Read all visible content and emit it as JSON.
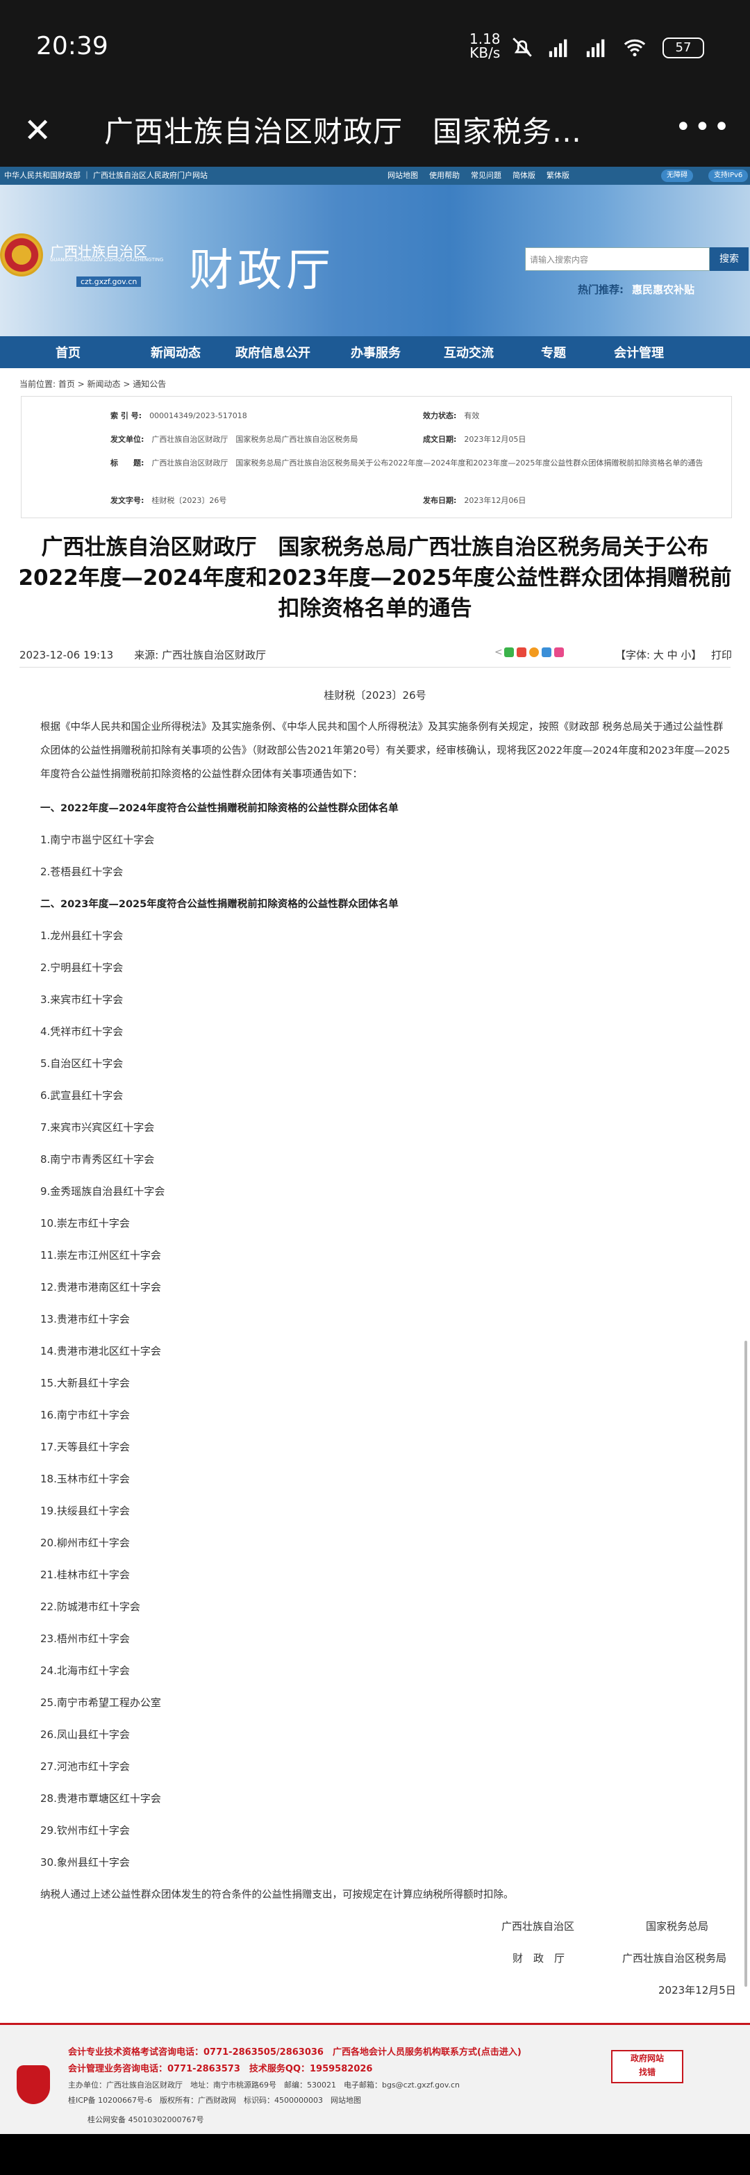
{
  "status": {
    "time": "20:39",
    "speed_top": "1.18",
    "speed_bottom": "KB/s",
    "battery": "57",
    "net1": "HD",
    "net2": "HD"
  },
  "title_bar": {
    "title": "广西壮族自治区财政厅　国家税务…"
  },
  "top_strip": {
    "left": "中华人民共和国财政部 ｜ 广西壮族自治区人民政府门户网站",
    "links": [
      "网站地图",
      "使用帮助",
      "常见问题",
      "简体版",
      "繁体版"
    ],
    "pill1": "无障碍",
    "pill2": "支持IPv6"
  },
  "header": {
    "region": "广西壮族自治区",
    "pinyin": "GUANGXI ZHUANGZU ZIZHIQU CAIZHENGTING",
    "url": "czt.gxzf.gov.cn",
    "name": "财政厅",
    "search_placeholder": "请输入搜索内容",
    "search_btn": "搜索",
    "hot_label": "热门推荐:",
    "hot_value": "惠民惠农补贴"
  },
  "nav": [
    "首页",
    "新闻动态",
    "政府信息公开",
    "办事服务",
    "互动交流",
    "专题",
    "会计管理"
  ],
  "breadcrumb": "当前位置: 首页 > 新闻动态 > 通知公告",
  "meta": {
    "idx_label": "索 引 号:",
    "idx": "000014349/2023-517018",
    "status_label": "效力状态:",
    "status": "有效",
    "unit_label": "发文单位:",
    "unit": "广西壮族自治区财政厅　国家税务总局广西壮族自治区税务局",
    "date_label": "成文日期:",
    "date": "2023年12月05日",
    "title_label": "标　　题:",
    "title": "广西壮族自治区财政厅　国家税务总局广西壮族自治区税务局关于公布2022年度—2024年度和2023年度—2025年度公益性群众团体捐赠税前扣除资格名单的通告",
    "docno_label": "发文字号:",
    "docno": "桂财税〔2023〕26号",
    "pub_label": "发布日期:",
    "pub": "2023年12月06日"
  },
  "article": {
    "title": "广西壮族自治区财政厅　国家税务总局广西壮族自治区税务局关于公布2022年度—2024年度和2023年度—2025年度公益性群众团体捐赠税前扣除资格名单的通告",
    "datetime": "2023-12-06 19:13",
    "source": "来源: 广西壮族自治区财政厅",
    "fontsize": "【字体: 大 中 小】",
    "print": "打印",
    "docno": "桂财税〔2023〕26号",
    "intro": "根据《中华人民共和国企业所得税法》及其实施条例、《中华人民共和国个人所得税法》及其实施条例有关规定，按照《财政部 税务总局关于通过公益性群众团体的公益性捐赠税前扣除有关事项的公告》（财政部公告2021年第20号）有关要求，经审核确认，现将我区2022年度—2024年度和2023年度—2025年度符合公益性捐赠税前扣除资格的公益性群众团体有关事项通告如下：",
    "sec1": "一、2022年度—2024年度符合公益性捐赠税前扣除资格的公益性群众团体名单",
    "list1": [
      "1.南宁市邕宁区红十字会",
      "2.苍梧县红十字会"
    ],
    "sec2": "二、2023年度—2025年度符合公益性捐赠税前扣除资格的公益性群众团体名单",
    "list2": [
      "1.龙州县红十字会",
      "2.宁明县红十字会",
      "3.来宾市红十字会",
      "4.凭祥市红十字会",
      "5.自治区红十字会",
      "6.武宣县红十字会",
      "7.来宾市兴宾区红十字会",
      "8.南宁市青秀区红十字会",
      "9.金秀瑶族自治县红十字会",
      "10.崇左市红十字会",
      "11.崇左市江州区红十字会",
      "12.贵港市港南区红十字会",
      "13.贵港市红十字会",
      "14.贵港市港北区红十字会",
      "15.大新县红十字会",
      "16.南宁市红十字会",
      "17.天等县红十字会",
      "18.玉林市红十字会",
      "19.扶绥县红十字会",
      "20.柳州市红十字会",
      "21.桂林市红十字会",
      "22.防城港市红十字会",
      "23.梧州市红十字会",
      "24.北海市红十字会",
      "25.南宁市希望工程办公室",
      "26.凤山县红十字会",
      "27.河池市红十字会",
      "28.贵港市覃塘区红十字会",
      "29.钦州市红十字会",
      "30.象州县红十字会"
    ],
    "closing": "纳税人通过上述公益性群众团体发生的符合条件的公益性捐赠支出，可按规定在计算应纳税所得额时扣除。",
    "sig1a": "广西壮族自治区",
    "sig1b": "财　政　厅",
    "sig2a": "国家税务总局",
    "sig2b": "广西壮族自治区税务局",
    "sigdate": "2023年12月5日"
  },
  "footer": {
    "line1": "会计专业技术资格考试咨询电话：0771-2863505/2863036　广西各地会计人员服务机构联系方式(点击进入)",
    "line2": "会计管理业务咨询电话：0771-2863573　技术服务QQ：1959582026",
    "line3": "主办单位：广西壮族自治区财政厅　地址：南宁市桃源路69号　邮编：530021　电子邮箱：bgs@czt.gxzf.gov.cn",
    "line4": "桂ICP备 10200667号-6　版权所有：广西财政网　标识码：4500000003　网站地图",
    "line5": "桂公网安备 45010302000767号",
    "gov_a": "政府网站",
    "gov_b": "找错"
  }
}
